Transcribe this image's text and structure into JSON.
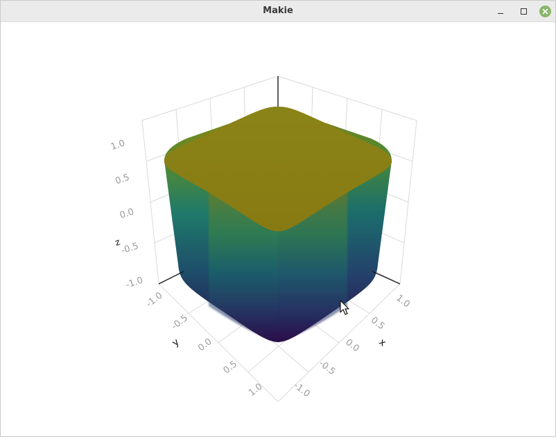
{
  "window": {
    "title": "Makie"
  },
  "colors": {
    "top": "#8b7e14",
    "mid": "#1d6e6c",
    "bottom": "#2b0f4c",
    "grid": "#d9d9d9",
    "tick": "#9a9a9a",
    "axis": "#1a1a1a",
    "close": "#8ab56b"
  },
  "icons": {
    "minimize": "minimize-icon",
    "maximize": "maximize-icon",
    "close": "close-icon",
    "cursor": "mouse-pointer-icon"
  },
  "axes": {
    "x": {
      "label": "x",
      "ticks": [
        "-1.0",
        "-0.5",
        "0.0",
        "0.5",
        "1.0"
      ]
    },
    "y": {
      "label": "y",
      "ticks": [
        "-1.0",
        "-0.5",
        "0.0",
        "0.5",
        "1.0"
      ]
    },
    "z": {
      "label": "z",
      "ticks": [
        "-1.0",
        "-0.5",
        "0.0",
        "0.5",
        "1.0"
      ]
    }
  }
}
